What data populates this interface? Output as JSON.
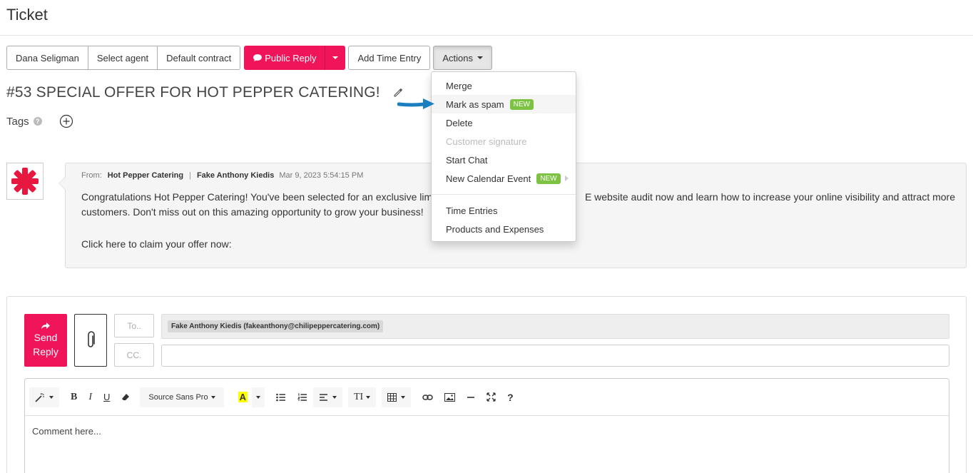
{
  "page": {
    "title": "Ticket"
  },
  "toolbar": {
    "customer": "Dana Seligman",
    "agent": "Select agent",
    "contract": "Default contract",
    "public_reply": "Public Reply",
    "add_time": "Add Time Entry",
    "actions": "Actions"
  },
  "ticket": {
    "title": "#53 SPECIAL OFFER FOR HOT PEPPER CATERING!",
    "tags_label": "Tags",
    "help_glyph": "?"
  },
  "actions_menu": {
    "items": [
      {
        "label": "Merge"
      },
      {
        "label": "Mark as spam",
        "badge": "NEW"
      },
      {
        "label": "Delete"
      },
      {
        "label": "Customer signature"
      },
      {
        "label": "Start Chat"
      },
      {
        "label": "New Calendar Event",
        "badge": "NEW"
      },
      {
        "label": "Time Entries"
      },
      {
        "label": "Products and Expenses"
      }
    ]
  },
  "message": {
    "from_label": "From:",
    "from_company": "Hot Pepper Catering",
    "separator": "|",
    "from_person": "Fake Anthony Kiedis",
    "timestamp": "Mar 9, 2023 5:54:15 PM",
    "body_line1_left": "Congratulations Hot Pepper Catering! You've been selected for an exclusive lim",
    "body_line1_right": "E website audit now and learn how to increase your online visibility and attract more",
    "body_line2": "customers. Don't miss out on this amazing opportunity to grow your business!",
    "link_text": "Click here to claim your offer now:"
  },
  "reply": {
    "send_line1": "Send",
    "send_line2": "Reply",
    "to_label": "To..",
    "cc_label": "CC.",
    "recipient": "Fake Anthony Kiedis (fakeanthony@chilipeppercatering.com)",
    "font_name": "Source Sans Pro",
    "placeholder": "Comment here..."
  },
  "editor_tools": {
    "bold": "B",
    "italic": "I",
    "underline": "U",
    "text_size": "TI",
    "help": "?"
  },
  "colors": {
    "accent": "#f0145a",
    "badge": "#7dc242",
    "arrow": "#1a7fc1"
  }
}
